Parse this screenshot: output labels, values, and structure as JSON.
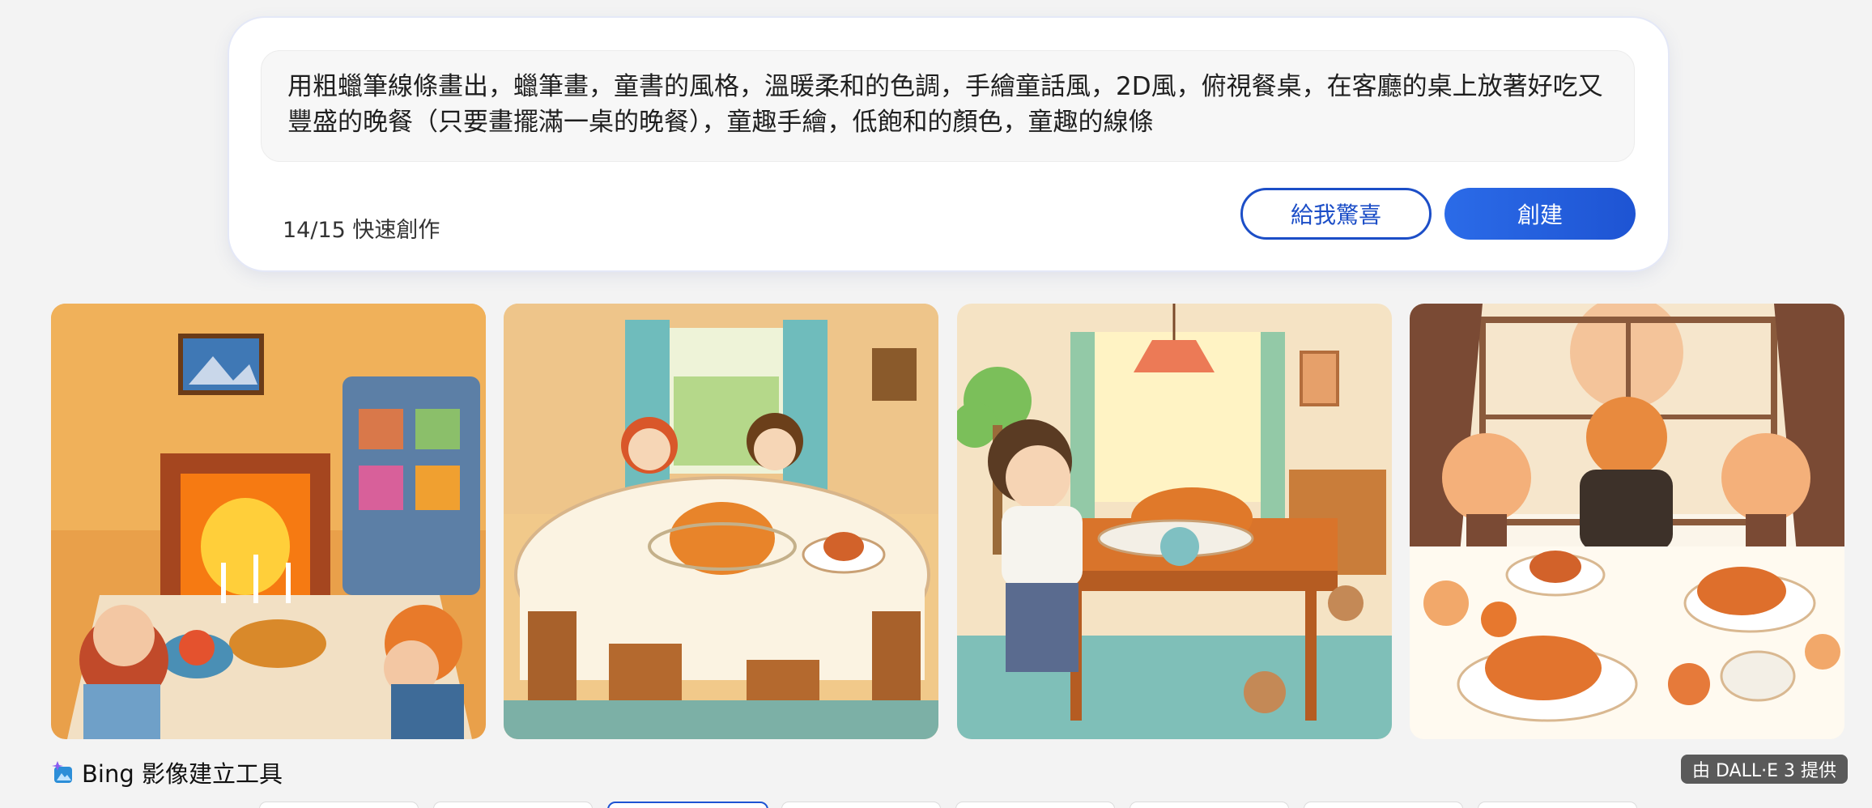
{
  "prompt": {
    "text": "用粗蠟筆線條畫出，蠟筆畫，童書的風格，溫暖柔和的色調，手繪童話風，2D風，俯視餐桌，在客廳的桌上放著好吃又豐盛的晚餐（只要畫擺滿一桌的晚餐），童趣手繪，低飽和的顏色，童趣的線條",
    "boosts_label": "14/15 快速創作",
    "surprise_label": "給我驚喜",
    "create_label": "創建"
  },
  "gallery": {
    "images": [
      {
        "name": "image-1",
        "description_icon": "generated-image"
      },
      {
        "name": "image-2",
        "description_icon": "generated-image"
      },
      {
        "name": "image-3",
        "description_icon": "generated-image"
      },
      {
        "name": "image-4",
        "description_icon": "generated-image"
      }
    ]
  },
  "footer": {
    "brand_label": "Bing 影像建立工具",
    "powered_by": "由 DALL·E 3 提供"
  },
  "colors": {
    "accent": "#1e54d3",
    "page_bg": "#f3f3f3"
  }
}
